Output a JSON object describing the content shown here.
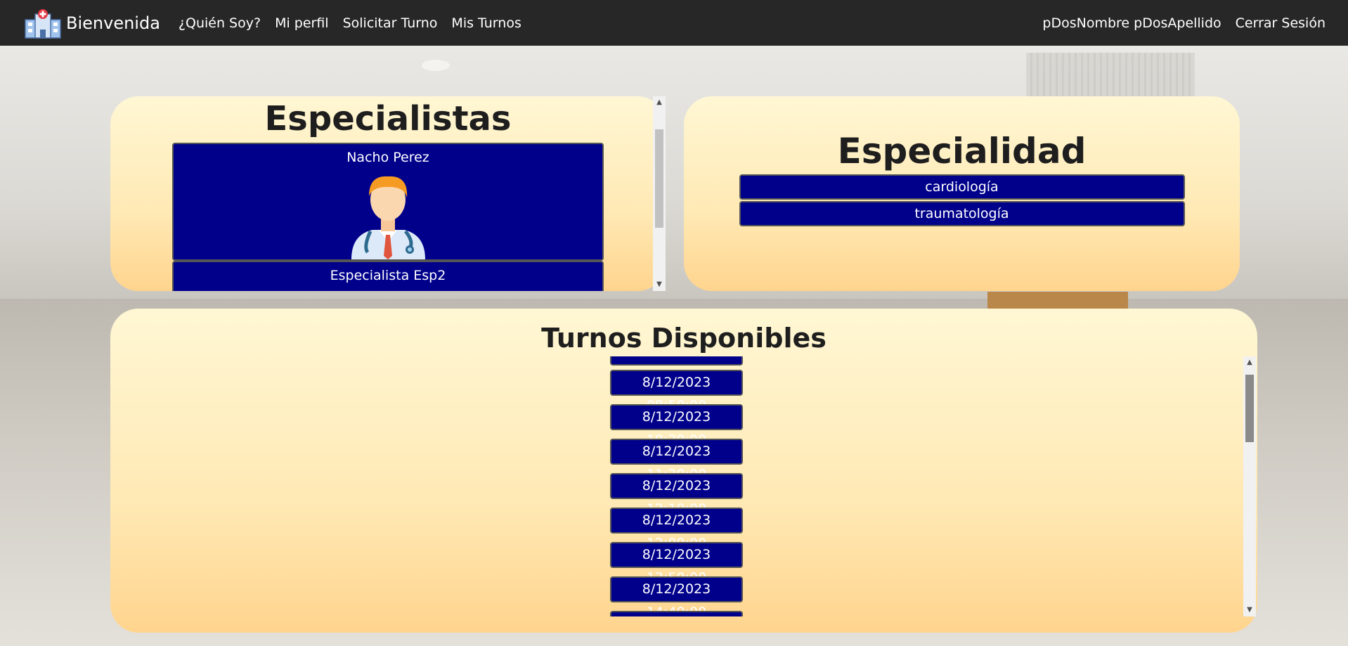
{
  "navbar": {
    "brand": "Bienvenida",
    "links": [
      "¿Quién Soy?",
      "Mi perfil",
      "Solicitar Turno",
      "Mis Turnos"
    ],
    "user_name": "pDosNombre pDosApellido",
    "logout": "Cerrar Sesión"
  },
  "specialists": {
    "title": "Especialistas",
    "items": [
      {
        "name": "Nacho Perez",
        "avatar": "doctor-avatar"
      },
      {
        "name": "Especialista Esp2",
        "avatar": "doctor-avatar"
      }
    ]
  },
  "speciality": {
    "title": "Especialidad",
    "items": [
      "cardiología",
      "traumatología"
    ]
  },
  "turnos": {
    "title": "Turnos Disponibles",
    "items": [
      "8/12/2023 08:50:00",
      "8/12/2023 10:30:00",
      "8/12/2023 11:20:00",
      "8/12/2023 12:10:00",
      "8/12/2023 13:00:00",
      "8/12/2023 13:50:00",
      "8/12/2023 14:40:00"
    ]
  },
  "colors": {
    "navbar": "#272727",
    "button": "#00008b",
    "panel_top": "#fff7d4",
    "panel_bottom": "#ffd48e"
  }
}
